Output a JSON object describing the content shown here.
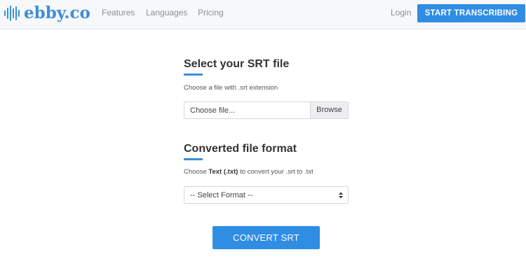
{
  "brand": {
    "name": "ebby.co",
    "color": "#3d8fd6"
  },
  "nav": {
    "links": [
      "Features",
      "Languages",
      "Pricing"
    ],
    "login": "Login",
    "cta": "START TRANSCRIBING"
  },
  "srt_section": {
    "title": "Select your SRT file",
    "helper": "Choose a file with .srt extension",
    "file_placeholder": "Choose file...",
    "browse_label": "Browse"
  },
  "format_section": {
    "title": "Converted file format",
    "helper_prefix": "Choose ",
    "helper_bold": "Text (.txt)",
    "helper_suffix": " to convert your .srt to .txt",
    "select_value": "-- Select Format --"
  },
  "convert_button": "CONVERT SRT",
  "colors": {
    "accent": "#2f8de4",
    "navbar_bg": "#f7f8fa"
  }
}
